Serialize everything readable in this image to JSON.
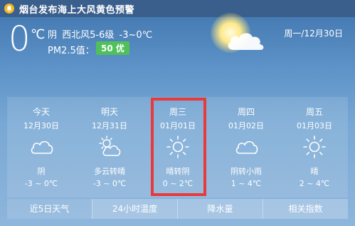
{
  "alert": {
    "icon": "bell-icon",
    "text": "烟台发布海上大风黄色预警"
  },
  "current": {
    "temperature": "0",
    "unit": "℃",
    "condition_line": "阴  西北风5-6级  -3~0℃",
    "pm_label": "PM2.5值：",
    "pm_badge": "50 优",
    "date": "周一/12月30日"
  },
  "forecast": [
    {
      "name": "今天",
      "date": "12月30日",
      "icon": "cloudy-icon",
      "condition": "阴",
      "range": "-3 ~ 0℃"
    },
    {
      "name": "明天",
      "date": "12月31日",
      "icon": "partly-cloudy-icon",
      "condition": "多云转晴",
      "range": "-3 ~ 0℃"
    },
    {
      "name": "周三",
      "date": "01月01日",
      "icon": "sunny-icon",
      "condition": "晴转阴",
      "range": "0 ~ 2℃"
    },
    {
      "name": "周四",
      "date": "01月02日",
      "icon": "cloudy-icon",
      "condition": "阴转小雨",
      "range": "1 ~ 4℃"
    },
    {
      "name": "周五",
      "date": "01月03日",
      "icon": "sunny-icon",
      "condition": "晴",
      "range": "2 ~ 4℃"
    }
  ],
  "tabs": [
    {
      "label": "近5日天气",
      "active": true
    },
    {
      "label": "24小时温度",
      "active": false
    },
    {
      "label": "降水量",
      "active": false
    },
    {
      "label": "相关指数",
      "active": false
    }
  ],
  "colors": {
    "highlight": "#e83a3a",
    "pm_good": "#4fc05a",
    "alert_icon": "#f1b81f"
  }
}
